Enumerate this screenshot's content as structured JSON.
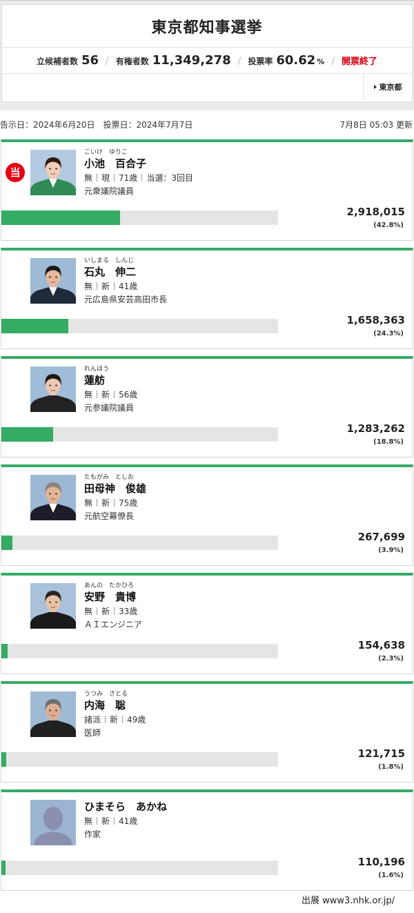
{
  "header": {
    "title": "東京都知事選挙",
    "stats": {
      "separator": "/",
      "candidates_label": "立候補者数",
      "candidates_value": "56",
      "electorate_label": "有権者数",
      "electorate_value": "11,349,278",
      "turnout_label": "投票率",
      "turnout_value": "60.62",
      "turnout_unit": "%",
      "count_status": "開票終了"
    },
    "region_link": {
      "icon": "caret-right-icon",
      "label": "東京都"
    }
  },
  "dates": {
    "announcement": "告示日：2024年6月20日",
    "voting": "投票日：2024年7月7日",
    "updated": "7月8日 05:03 更新"
  },
  "candidates": [
    {
      "elected": true,
      "elected_label": "当",
      "furigana": "こいけ　ゆりこ",
      "name": "小池　百合子",
      "tags": [
        "無",
        "現",
        "71歳",
        "当選：3回目"
      ],
      "career": "元衆議院議員",
      "votes": "2,918,015",
      "share": 42.8,
      "share_label": "(42.8%)",
      "photo": {
        "icon": "candidate-photo",
        "bg": "#b3cae0",
        "skin": "#f0cdb6",
        "hair": "#2b1b12",
        "clothes": "#2f8a55",
        "shirt": "#f4f4f4"
      }
    },
    {
      "furigana": "いしまる　しんじ",
      "name": "石丸　伸二",
      "tags": [
        "無",
        "新",
        "41歳"
      ],
      "career": "元広島県安芸高田市長",
      "votes": "1,658,363",
      "share": 24.3,
      "share_label": "(24.3%)",
      "photo": {
        "icon": "candidate-photo",
        "bg": "#9dbad6",
        "skin": "#e4b99c",
        "hair": "#1a1a1a",
        "clothes": "#1f2a3a",
        "shirt": "#f2f2f2"
      }
    },
    {
      "furigana": "れんほう",
      "name": "蓮舫",
      "tags": [
        "無",
        "新",
        "56歳"
      ],
      "career": "元参議院議員",
      "votes": "1,283,262",
      "share": 18.8,
      "share_label": "(18.8%)",
      "photo": {
        "icon": "candidate-photo",
        "bg": "#9fbcd8",
        "skin": "#ecc7b1",
        "hair": "#1e1612",
        "clothes": "#222222",
        "shirt": "#222222"
      }
    },
    {
      "furigana": "たもがみ　としお",
      "name": "田母神　俊雄",
      "tags": [
        "無",
        "新",
        "75歳"
      ],
      "career": "元航空幕僚長",
      "votes": "267,699",
      "share": 3.9,
      "share_label": "(3.9%)",
      "photo": {
        "icon": "candidate-photo",
        "bg": "#9cb8d4",
        "skin": "#e2b596",
        "hair": "#8c847c",
        "clothes": "#1d1d2a",
        "shirt": "#ffffff"
      }
    },
    {
      "furigana": "あんの　たかひろ",
      "name": "安野　貴博",
      "tags": [
        "無",
        "新",
        "33歳"
      ],
      "career": "ＡＩエンジニア",
      "votes": "154,638",
      "share": 2.3,
      "share_label": "(2.3%)",
      "photo": {
        "icon": "candidate-photo",
        "bg": "#a9c1da",
        "skin": "#e6c1a6",
        "hair": "#2a2420",
        "clothes": "#1a1a1a",
        "shirt": "#1a1a1a"
      }
    },
    {
      "furigana": "うつみ　さとる",
      "name": "内海　聡",
      "tags": [
        "諸派",
        "新",
        "49歳"
      ],
      "career": "医師",
      "votes": "121,715",
      "share": 1.8,
      "share_label": "(1.8%)",
      "photo": {
        "icon": "candidate-photo",
        "bg": "#9ebad5",
        "skin": "#dcae92",
        "hair": "#6e6e6e",
        "clothes": "#202020",
        "shirt": "#202020"
      }
    },
    {
      "name": "ひまそら　あかね",
      "tags": [
        "無",
        "新",
        "41歳"
      ],
      "career": "作家",
      "votes": "110,196",
      "share": 1.6,
      "share_label": "(1.6%)",
      "photo": {
        "icon": "person-silhouette-icon",
        "bg": "#9bb4d2",
        "figure": "#8b8fae"
      }
    }
  ],
  "footer": {
    "source": "出展 www3.nhk.or.jp/"
  },
  "colors": {
    "accent_green": "#35ab64",
    "bar_track": "#e5e5e5",
    "status_red": "#d7000f",
    "elected_badge_red": "#e60012",
    "card_border": "#d3d3d3"
  }
}
